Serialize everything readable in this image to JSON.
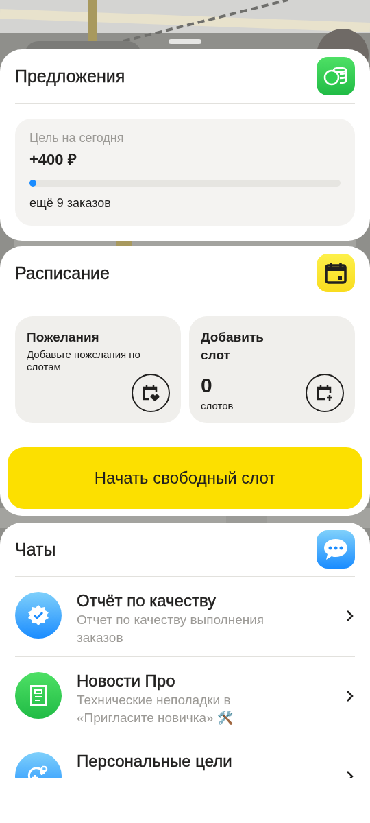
{
  "offers": {
    "title": "Предложения",
    "goal": {
      "label": "Цель на сегодня",
      "amount": "+400 ₽",
      "level": 0.01,
      "remaining": "ещё 9 заказов"
    }
  },
  "schedule": {
    "title": "Расписание",
    "cards": [
      {
        "kind": "wishes",
        "title": "Пожелания",
        "description": "Добавьте пожелания по слотам"
      },
      {
        "kind": "add_slot",
        "title": "Добавить слот",
        "count": "0",
        "unit": "слотов"
      }
    ],
    "button": "Начать свободный слот"
  },
  "chats": {
    "title": "Чаты",
    "items": [
      {
        "kind": "quality",
        "title": "Отчёт по качеству",
        "subtitle": "Отчет по качеству выполнения заказов"
      },
      {
        "kind": "news",
        "title": "Новости Про",
        "subtitle": "Технические неполадки в «Пригласите новичка» 🛠️"
      },
      {
        "kind": "goals",
        "title": "Персональные цели"
      }
    ]
  }
}
